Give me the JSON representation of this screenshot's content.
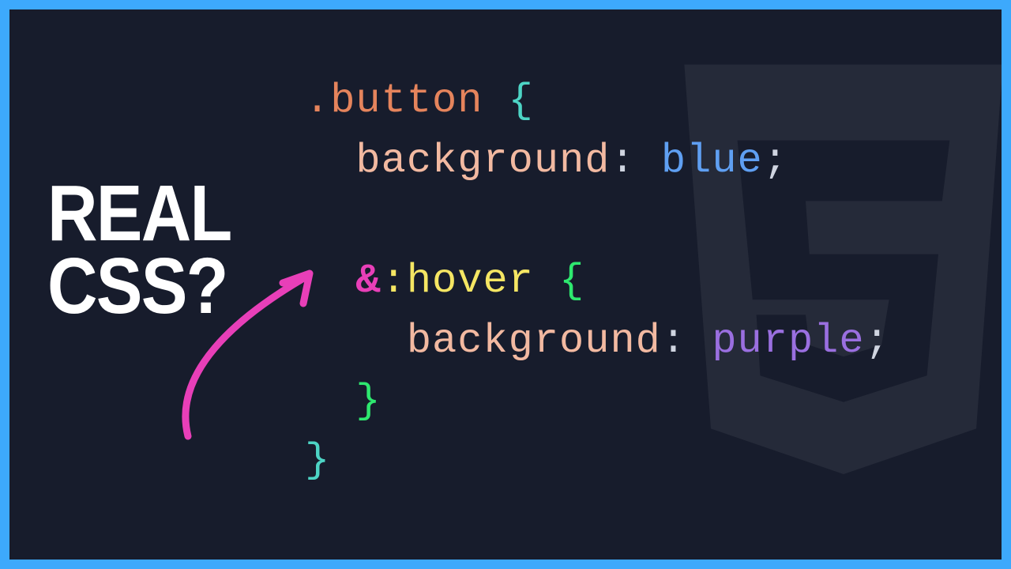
{
  "headline": {
    "line1": "REAL",
    "line2": "CSS?"
  },
  "code": {
    "selector": ".button",
    "brace_open_outer": "{",
    "prop1_name": "background",
    "colon": ":",
    "prop1_value": "blue",
    "semicolon": ";",
    "amp": "&",
    "pseudo": ":hover",
    "brace_open_inner": "{",
    "prop2_name": "background",
    "prop2_value": "purple",
    "brace_close_inner": "}",
    "brace_close_outer": "}"
  },
  "colors": {
    "border": "#3da9fc",
    "bg": "#171c2c",
    "arrow": "#e83fb8"
  }
}
